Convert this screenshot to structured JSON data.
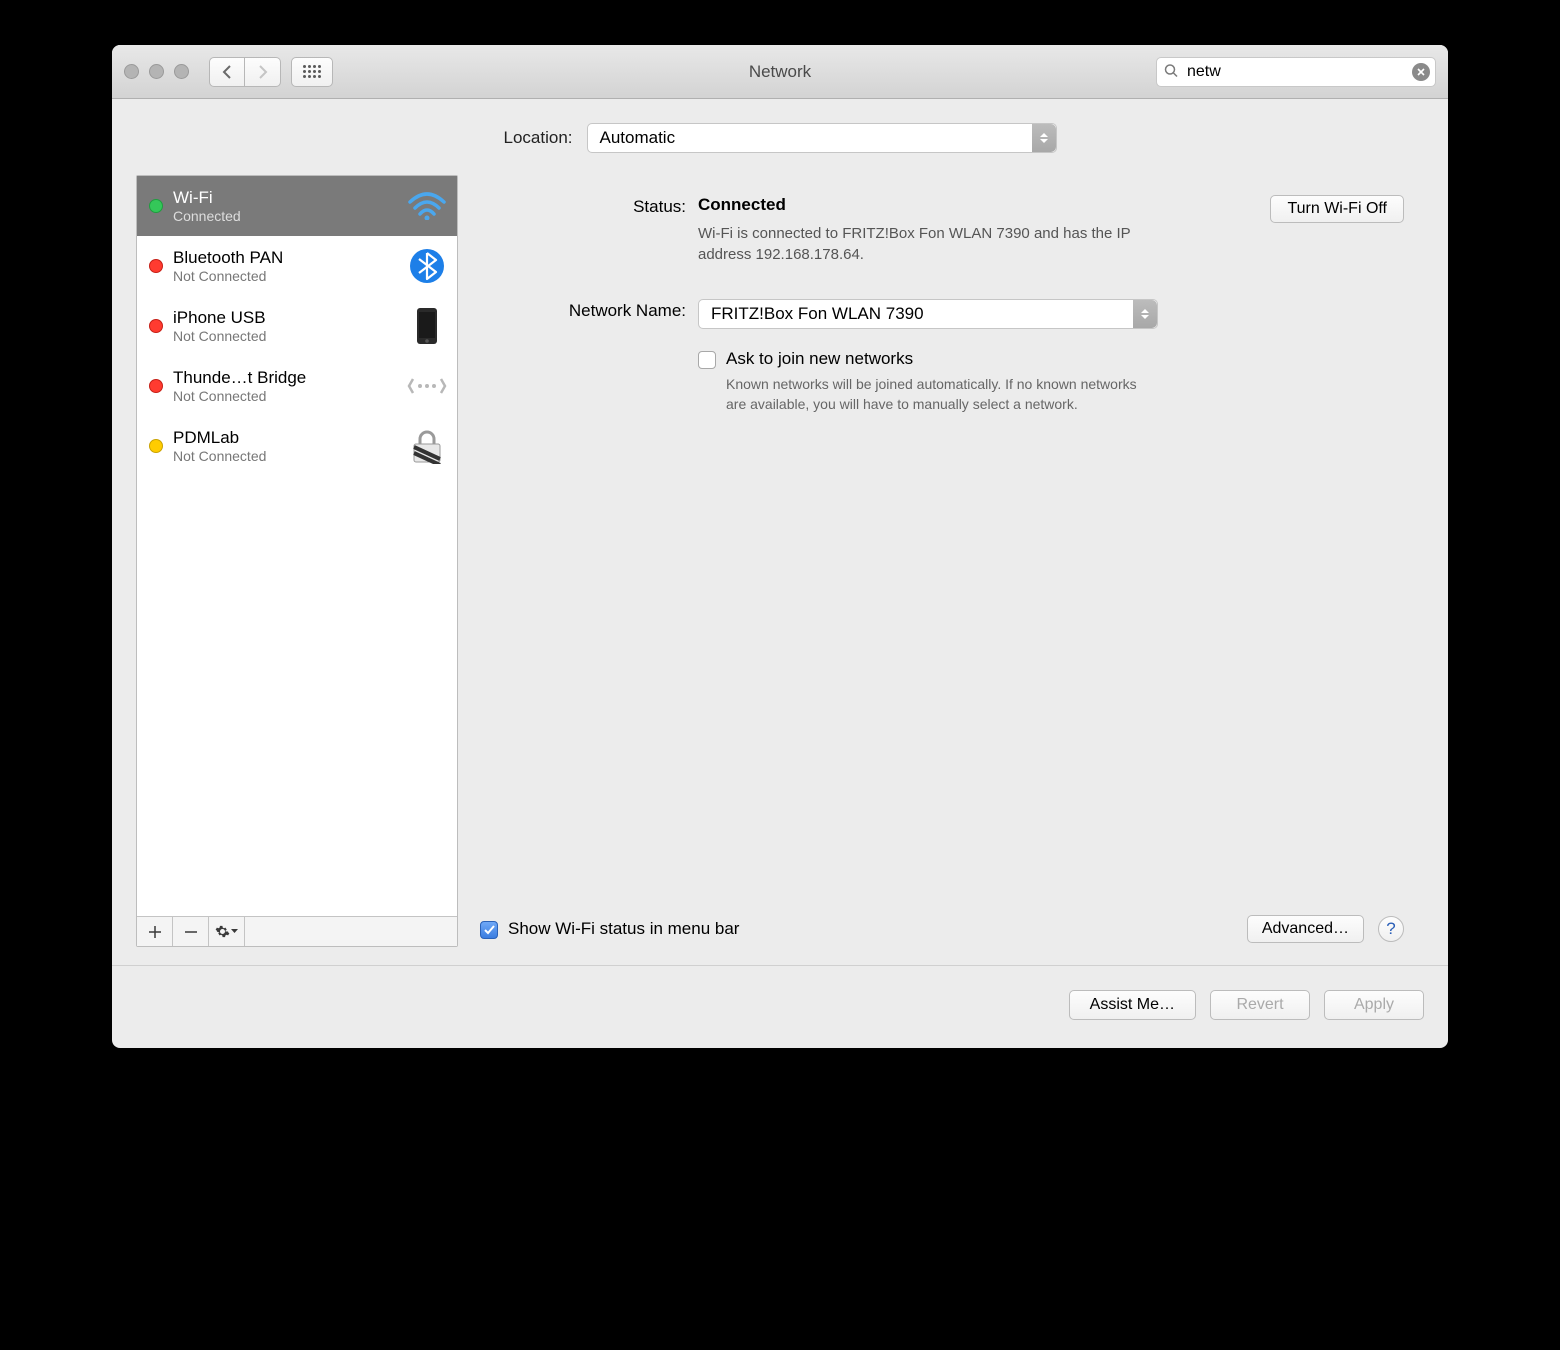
{
  "window": {
    "title": "Network"
  },
  "search": {
    "value": "netw"
  },
  "location": {
    "label": "Location:",
    "value": "Automatic"
  },
  "sidebar": {
    "items": [
      {
        "name": "Wi-Fi",
        "status": "Connected",
        "dot": "green",
        "icon": "wifi",
        "selected": true
      },
      {
        "name": "Bluetooth PAN",
        "status": "Not Connected",
        "dot": "red",
        "icon": "bluetooth",
        "selected": false
      },
      {
        "name": "iPhone USB",
        "status": "Not Connected",
        "dot": "red",
        "icon": "phone",
        "selected": false
      },
      {
        "name": "Thunde…t Bridge",
        "status": "Not Connected",
        "dot": "red",
        "icon": "bridge",
        "selected": false
      },
      {
        "name": "PDMLab",
        "status": "Not Connected",
        "dot": "yellow",
        "icon": "vpn",
        "selected": false
      }
    ]
  },
  "detail": {
    "status_label": "Status:",
    "status_value": "Connected",
    "toggle_label": "Turn Wi-Fi Off",
    "status_desc": "Wi-Fi is connected to FRITZ!Box Fon WLAN 7390 and has the IP address 192.168.178.64.",
    "network_label": "Network Name:",
    "network_value": "FRITZ!Box Fon WLAN 7390",
    "ask_label": "Ask to join new networks",
    "ask_desc": "Known networks will be joined automatically. If no known networks are available, you will have to manually select a network.",
    "show_status_label": "Show Wi-Fi status in menu bar",
    "advanced_label": "Advanced…"
  },
  "footer": {
    "assist": "Assist Me…",
    "revert": "Revert",
    "apply": "Apply"
  }
}
